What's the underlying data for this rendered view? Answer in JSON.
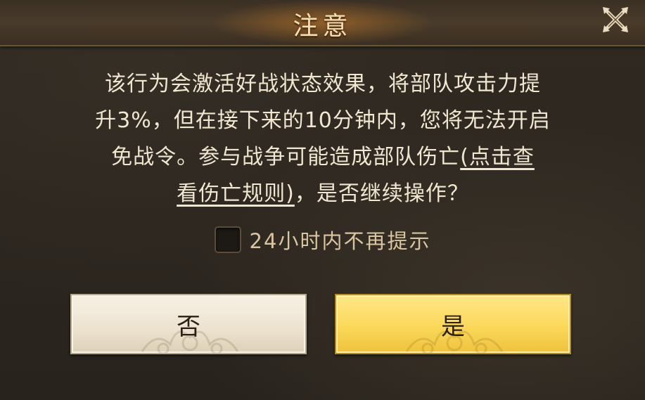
{
  "dialog": {
    "title": "注意",
    "close_icon": "close-x-icon",
    "message": {
      "line1": "该行为会激活好战状态效果，将部队攻击力提",
      "line2": "升3%，但在接下来的10分钟内，您将无法开启",
      "line3_before_link": "免战令。参与战争可能造成部队伤亡",
      "link_part1": "(点击查",
      "link_part2": "看伤亡规则)",
      "line4_after_link": "，是否继续操作？"
    },
    "checkbox": {
      "label": "24小时内不再提示",
      "checked": false
    },
    "buttons": {
      "no_label": "否",
      "yes_label": "是"
    }
  },
  "colors": {
    "title_text": "#f3dfb8",
    "body_text": "#f1e6cf",
    "checkbox_label": "#d9c59f",
    "no_button_bg": "#ece2cf",
    "yes_button_bg": "#fbd85a",
    "header_glow": "#e68c28"
  }
}
